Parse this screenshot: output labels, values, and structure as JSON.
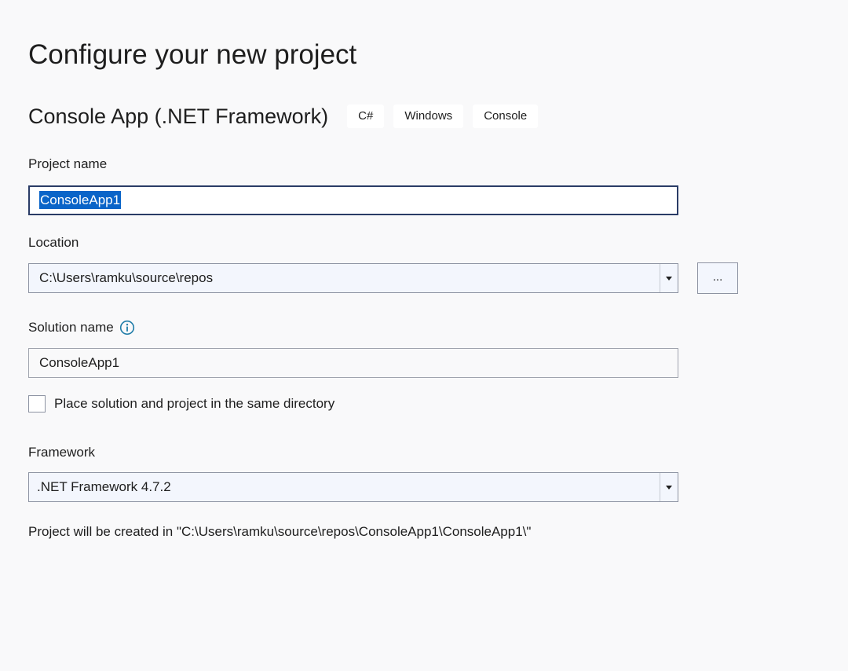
{
  "page": {
    "title": "Configure your new project"
  },
  "template": {
    "name": "Console App (.NET Framework)",
    "tags": [
      "C#",
      "Windows",
      "Console"
    ]
  },
  "project_name": {
    "label": "Project name",
    "value": "ConsoleApp1"
  },
  "location": {
    "label": "Location",
    "value": "C:\\Users\\ramku\\source\\repos",
    "browse_label": "..."
  },
  "solution_name": {
    "label": "Solution name",
    "value": "ConsoleApp1",
    "info_icon": "info-icon"
  },
  "same_directory": {
    "label": "Place solution and project in the same directory",
    "checked": false
  },
  "framework": {
    "label": "Framework",
    "value": ".NET Framework 4.7.2"
  },
  "creation_note": "Project will be created in \"C:\\Users\\ramku\\source\\repos\\ConsoleApp1\\ConsoleApp1\\\"",
  "colors": {
    "background": "#f9f9fa",
    "selection": "#0a64c8",
    "focus_border": "#2a3c66",
    "info_icon": "#1f7ca8"
  }
}
